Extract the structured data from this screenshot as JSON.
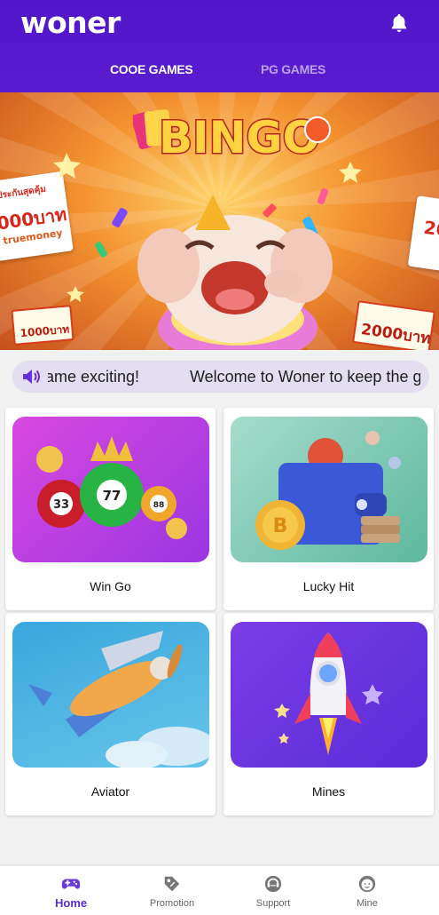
{
  "header": {
    "logo": "woner",
    "tabs": [
      {
        "label": "COOE GAMES",
        "active": true
      },
      {
        "label": "PG GAMES",
        "active": false
      }
    ]
  },
  "banner": {
    "title": "BINGO",
    "left_card_line1": "ประกันสุดคุ้ม",
    "left_card_amount": "000บาท",
    "left_card_brand": "truemoney",
    "left_ticket": "1000บาท",
    "right_ticket": "2000บาท",
    "right_card_amount": "20"
  },
  "marquee": {
    "text_a": "game exciting!",
    "text_b": "Welcome to Woner to keep the g"
  },
  "games": [
    {
      "label": "Win Go"
    },
    {
      "label": "Lucky Hit"
    },
    {
      "label": "Aviator"
    },
    {
      "label": "Mines"
    }
  ],
  "bottom_nav": [
    {
      "label": "Home",
      "active": true
    },
    {
      "label": "Promotion",
      "active": false
    },
    {
      "label": "Support",
      "active": false
    },
    {
      "label": "Mine",
      "active": false
    }
  ],
  "colors": {
    "header": "#5016c8",
    "accent": "#5a2bd9",
    "marquee_bg": "#e3def0"
  }
}
